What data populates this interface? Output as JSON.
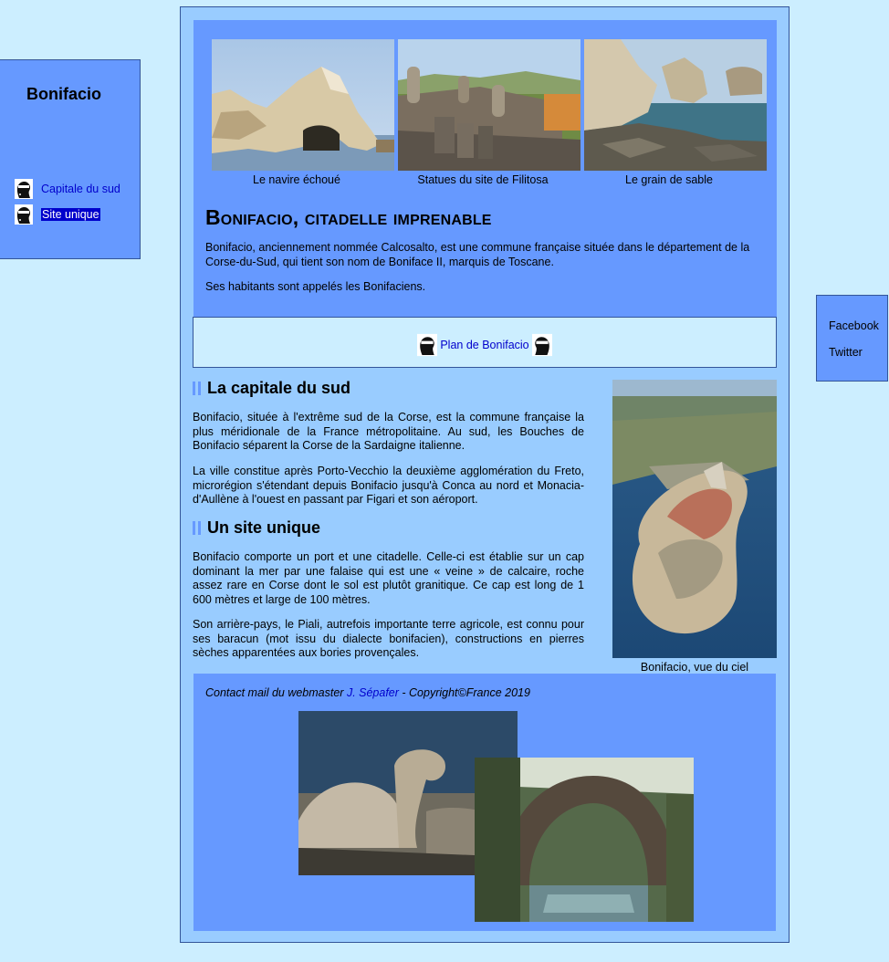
{
  "nav": {
    "title": "Bonifacio",
    "items": [
      {
        "label": "Capitale du sud",
        "active": false
      },
      {
        "label": "Site unique",
        "active": true
      }
    ]
  },
  "social": {
    "facebook": "Facebook",
    "twitter": "Twitter"
  },
  "gallery": [
    {
      "caption": "Le navire échoué"
    },
    {
      "caption": "Statues du site de Filitosa"
    },
    {
      "caption": "Le grain de sable"
    }
  ],
  "intro": {
    "title": "Bonifacio, citadelle imprenable",
    "p1": "Bonifacio, anciennement nommée Calcosalto, est une commune française située dans le département de la Corse-du-Sud, qui tient son nom de Boniface II, marquis de Toscane.",
    "p2": "Ses habitants sont appelés les Bonifaciens."
  },
  "plan_link": "Plan de Bonifacio",
  "sections": [
    {
      "heading": "La capitale du sud",
      "paragraphs": [
        "Bonifacio, située à l'extrême sud de la Corse, est la commune française la plus méridionale de la France métropolitaine. Au sud, les Bouches de Bonifacio séparent la Corse de la Sardaigne italienne.",
        "La ville constitue après Porto-Vecchio la deuxième agglomération du Freto, microrégion s'étendant depuis Bonifacio jusqu'à Conca au nord et Monacia-d'Aullène à l'ouest en passant par Figari et son aéroport."
      ]
    },
    {
      "heading": "Un site unique",
      "paragraphs": [
        "Bonifacio comporte un port et une citadelle. Celle-ci est établie sur un cap dominant la mer par une falaise qui est une « veine » de calcaire, roche assez rare en Corse dont le sol est plutôt granitique. Ce cap est long de 1 600 mètres et large de 100 mètres.",
        "Son arrière-pays, le Piali, autrefois importante terre agricole, est connu pour ses baracun (mot issu du dialecte bonifacien), constructions en pierres sèches apparentées aux bories provençales."
      ]
    }
  ],
  "aerial_caption": "Bonifacio, vue du ciel",
  "footer": {
    "prefix": "Contact mail du webmaster ",
    "link": "J. Sépafer",
    "suffix": " - Copyright©France 2019"
  },
  "colors": {
    "page_bg": "#cceeff",
    "panel": "#6699ff",
    "frame": "#99ccff",
    "link": "#0000cc"
  }
}
